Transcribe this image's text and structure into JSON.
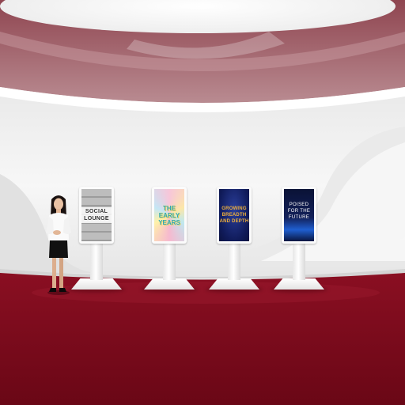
{
  "scene": {
    "colors": {
      "floor": "#7a0a1b",
      "ceiling": "#a05a64",
      "wall": "#f2f2f2"
    }
  },
  "kiosks": [
    {
      "screen_text": "SOCIAL LOUNGE"
    },
    {
      "screen_text": "THE EARLY YEARS"
    },
    {
      "screen_text": "GROWING BREADTH AND DEPTH"
    },
    {
      "screen_text": "POISED FOR THE FUTURE"
    }
  ]
}
